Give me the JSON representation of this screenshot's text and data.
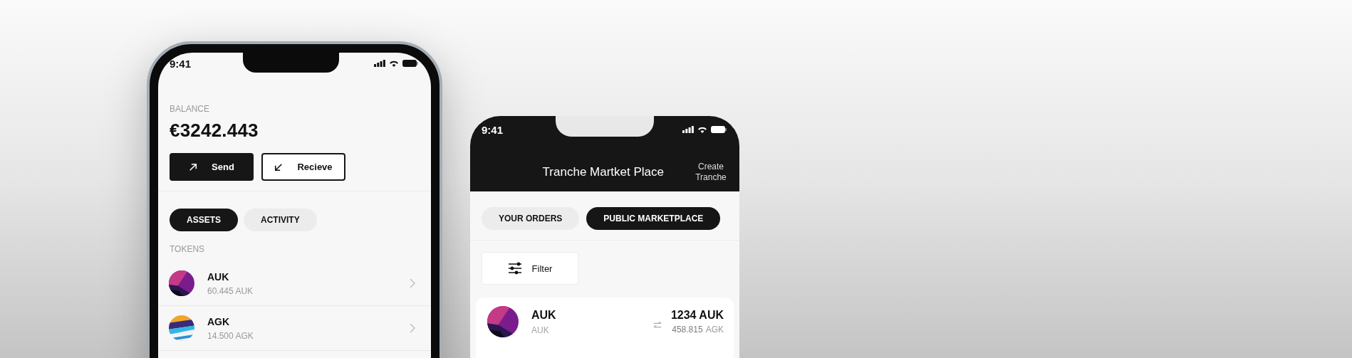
{
  "wallet_phone": {
    "status_bar": {
      "time": "9:41"
    },
    "balance": {
      "label": "BALANCE",
      "amount": "€3242.443"
    },
    "buttons": [
      {
        "label": "Send",
        "kind": "send"
      },
      {
        "label": "Recieve",
        "kind": "receive"
      }
    ],
    "tabs": [
      {
        "label": "ASSETS",
        "selected": true
      },
      {
        "label": "ACTIVITY",
        "selected": false
      }
    ],
    "section_title": "TOKENS",
    "tokens": [
      {
        "name": "AUK",
        "balance": "60.445 AUK"
      },
      {
        "name": "AGK",
        "balance": "14.500 AGK"
      }
    ]
  },
  "market_phone": {
    "status_bar": {
      "time": "9:41"
    },
    "title": "Tranche Martket Place",
    "header_action": "Create Tranche",
    "tabs": [
      {
        "label": "YOUR ORDERS",
        "selected": false
      },
      {
        "label": "PUBLIC MARKETPLACE",
        "selected": true
      }
    ],
    "filter_button": "Filter",
    "listings": [
      {
        "name": "AUK",
        "subtitle": "AUK",
        "amount": "1234 AUK",
        "value": "458.815",
        "value_unit": "AGK"
      }
    ]
  }
}
